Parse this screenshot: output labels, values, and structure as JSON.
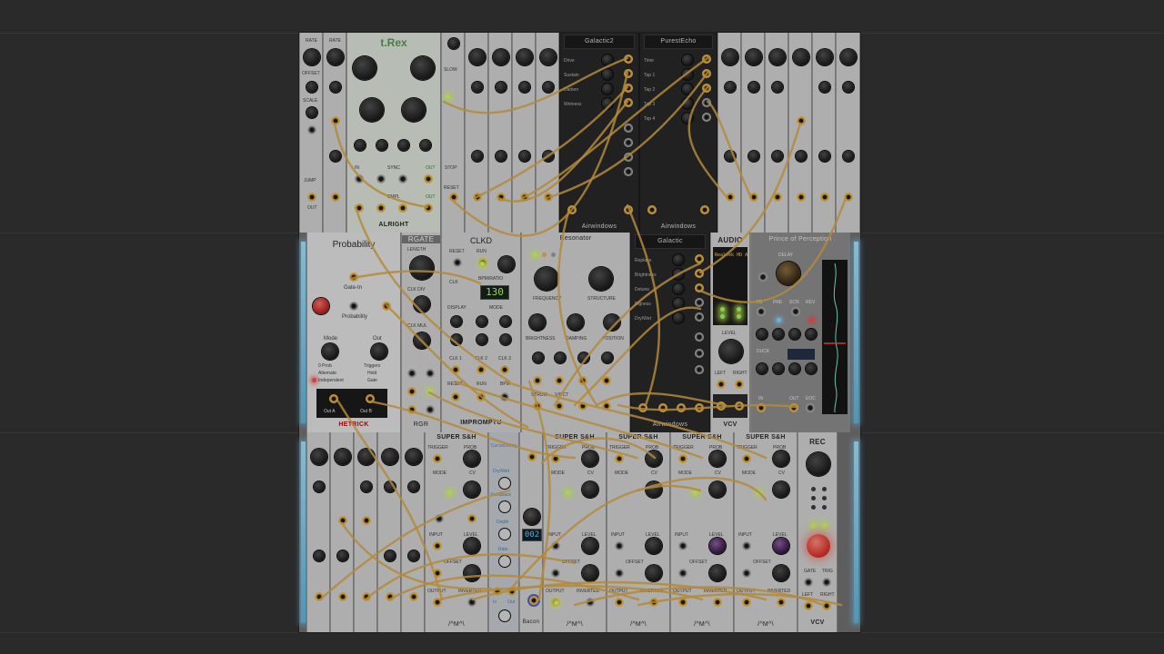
{
  "rack": {
    "row1": {
      "lfo_label_rate": "RATE",
      "lfo_label_offset": "OFFSET",
      "lfo_label_scale": "SCALE",
      "lfo_label_jump": "JUMP",
      "lfo_label_out": "OUT",
      "trex_title": "t.Rex",
      "trex_brand": "ALRIGHT",
      "trex_labels": [
        "IN",
        "SYNC",
        "OUT",
        "SMPL",
        "OUT"
      ],
      "seq_labels": [
        "SLOW",
        "STOP",
        "RESET"
      ],
      "galactic2": {
        "header": "Galactic2",
        "params": [
          "Drive",
          "Sustain",
          "Darken",
          "Wetness"
        ],
        "footer": "Airwindows"
      },
      "purestecho": {
        "header": "PurestEcho",
        "params": [
          "Time",
          "Tap 1",
          "Tap 2",
          "Tap 3",
          "Tap 4"
        ],
        "footer": "Airwindows"
      }
    },
    "row2": {
      "probability": {
        "title": "Probability",
        "gate_in": "Gate-In",
        "prob_label": "Probability",
        "mode_label": "Mode",
        "out_label": "Out",
        "modes": [
          "0 Prob",
          "Alternate",
          "Independent"
        ],
        "outs": [
          "Triggers",
          "Hold",
          "Gate"
        ],
        "out_a": "Out A",
        "out_b": "Out B",
        "brand": "HETRICK"
      },
      "rgate": {
        "title": "RGATE",
        "length": "LENGTH",
        "clk_div": "CLK DIV",
        "clk_mul": "CLK MUL",
        "brand": "RGR"
      },
      "clkd": {
        "title": "CLKD",
        "labels": [
          "RESET",
          "RUN",
          "BPM/RATIO",
          "CLK",
          "DISPLAY",
          "MODE",
          "CLK 1",
          "CLK 2",
          "CLK 3",
          "RESET",
          "RUN",
          "BPM"
        ],
        "display": "130",
        "brand": "IMPROMPTU"
      },
      "resonator": {
        "title": "Resonator",
        "labels": [
          "FREQUENCY",
          "STRUCTURE",
          "BRIGHTNESS",
          "DAMPING",
          "POSITION",
          "STRUM",
          "V/OCT"
        ]
      },
      "galactic": {
        "header": "Galactic",
        "params": [
          "Replace",
          "Brightness",
          "Detune",
          "Bigness",
          "Dry/Wet"
        ],
        "footer": "Airwindows"
      },
      "audio": {
        "title": "AUDIO",
        "device": "Realtek HD A",
        "level": "LEVEL",
        "left": "LEFT",
        "right": "RIGHT",
        "brand": "VCV"
      },
      "prince": {
        "title": "Prince of Perception",
        "delay": "DELAY",
        "row_labels": [
          "FB",
          "PRE",
          "SCN",
          "REV"
        ],
        "duck": "DUCK",
        "in": "IN",
        "out": "OUT",
        "eoc": "EOC"
      }
    },
    "row3": {
      "sh_title": "SUPER S&H",
      "sh_labels": [
        "TRIGGER",
        "PROB",
        "MODE",
        "CV",
        "INPUT",
        "LEVEL",
        "OFFSET",
        "OUTPUT",
        "INVERTED"
      ],
      "sh_brand": "/^M^\\",
      "curvedelay": {
        "title": "CurveDelay",
        "labels": [
          "Dry/Wet",
          "Feedback",
          "Depth",
          "Rate",
          "Out",
          "In"
        ]
      },
      "bacon": {
        "display": "002",
        "brand": "Bacon"
      },
      "rec": {
        "title": "REC",
        "labels": [
          "GATE",
          "TRIG",
          "LEFT",
          "RIGHT"
        ],
        "brand": "VCV"
      }
    }
  },
  "colors": {
    "background": "#2b2b2b",
    "cable": "#d9a441",
    "led_green": "#d9ff5c",
    "side_light": "#7fd8ff",
    "record": "#e4322a"
  }
}
